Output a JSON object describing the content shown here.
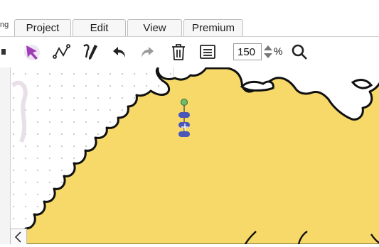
{
  "tabs": {
    "partial_label": "ng",
    "items": [
      {
        "label": "Project"
      },
      {
        "label": "Edit"
      },
      {
        "label": "View"
      },
      {
        "label": "Premium"
      }
    ]
  },
  "toolbar": {
    "tools": [
      {
        "icon": "select-arrow-icon",
        "color": "#a03cb8"
      },
      {
        "icon": "node-edit-icon"
      },
      {
        "icon": "pencil-draw-icon"
      },
      {
        "icon": "undo-icon"
      },
      {
        "icon": "redo-icon"
      },
      {
        "icon": "trash-icon"
      },
      {
        "icon": "list-icon"
      },
      {
        "icon": "zoom-icon"
      }
    ],
    "zoom_value": "150",
    "zoom_unit": "%"
  },
  "colors": {
    "shape_fill": "#f7d96a",
    "shape_stroke": "#111111",
    "handle_fill": "#4a56b8",
    "rotate_handle": "#6dbd6d",
    "accent": "#a03cb8"
  }
}
